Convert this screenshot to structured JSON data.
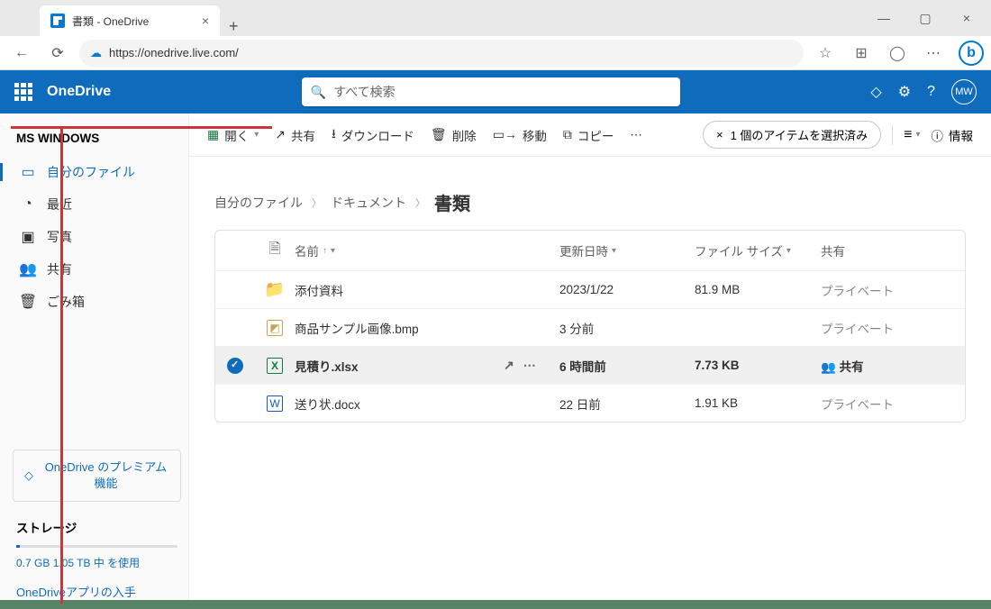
{
  "browser": {
    "tab_title": "書類 - OneDrive",
    "url": "https://onedrive.live.com/"
  },
  "header": {
    "brand": "OneDrive",
    "search_placeholder": "すべて検索",
    "avatar": "MW"
  },
  "sidebar": {
    "account": "MS WINDOWS",
    "items": [
      {
        "icon": "folder",
        "label": "自分のファイル",
        "active": true
      },
      {
        "icon": "clock",
        "label": "最近"
      },
      {
        "icon": "photo",
        "label": "写真"
      },
      {
        "icon": "people",
        "label": "共有"
      },
      {
        "icon": "trash",
        "label": "ごみ箱"
      }
    ],
    "premium": "OneDrive のプレミアム機能",
    "storage_label": "ストレージ",
    "storage_text": "0.7 GB 1.05 TB 中 を使用",
    "get_app": "OneDriveアプリの入手"
  },
  "toolbar": {
    "open": "開く",
    "share": "共有",
    "download": "ダウンロード",
    "delete": "削除",
    "move": "移動",
    "copy": "コピー",
    "selected_text": "1 個のアイテムを選択済み",
    "info": "情報"
  },
  "breadcrumb": {
    "root": "自分のファイル",
    "mid": "ドキュメント",
    "current": "書類"
  },
  "columns": {
    "name": "名前",
    "modified": "更新日時",
    "size": "ファイル サイズ",
    "sharing": "共有"
  },
  "rows": [
    {
      "type": "folder",
      "name": "添付資料",
      "modified": "2023/1/22",
      "size": "81.9 MB",
      "sharing": "プライベート",
      "selected": false
    },
    {
      "type": "bmp",
      "name": "商品サンプル画像.bmp",
      "modified": "3 分前",
      "size": "",
      "sharing": "プライベート",
      "selected": false
    },
    {
      "type": "xlsx",
      "name": "見積り.xlsx",
      "modified": "6 時間前",
      "size": "7.73 KB",
      "sharing": "共有",
      "selected": true
    },
    {
      "type": "docx",
      "name": "送り状.docx",
      "modified": "22 日前",
      "size": "1.91 KB",
      "sharing": "プライベート",
      "selected": false
    }
  ]
}
